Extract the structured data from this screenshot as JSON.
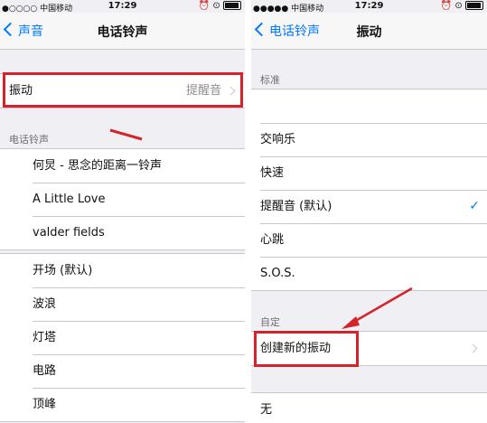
{
  "left": {
    "status": {
      "carrier": "●○○○○ 中国移动",
      "time": "17:29",
      "icons": "⏰ ⊙"
    },
    "nav": {
      "back": "声音",
      "title": "电话铃声"
    },
    "vibration_row": {
      "label": "振动",
      "value": "提醒音"
    },
    "ringtones_header": "电话铃声",
    "ringtones": [
      "何炅 - 思念的距离一铃声",
      "A Little Love",
      "valder fields"
    ],
    "standard_ringtones": [
      "开场 (默认)",
      "波浪",
      "灯塔",
      "电路",
      "顶峰"
    ]
  },
  "right": {
    "status": {
      "carrier": "●●●●● 中国移动",
      "time": "17:29",
      "icons": "⏰ ⊙"
    },
    "nav": {
      "back": "电话铃声",
      "title": "振动"
    },
    "standard_header": "标准",
    "standard": [
      {
        "label": "",
        "selected": false
      },
      {
        "label": "交响乐",
        "selected": false
      },
      {
        "label": "快速",
        "selected": false
      },
      {
        "label": "提醒音 (默认)",
        "selected": true
      },
      {
        "label": "心跳",
        "selected": false
      },
      {
        "label": "S.O.S.",
        "selected": false
      }
    ],
    "custom_header": "自定",
    "create_label": "创建新的振动",
    "none_label": "无",
    "check_mark": "✓"
  },
  "accent_color": "#007aff",
  "annotation_color": "#d5232b"
}
